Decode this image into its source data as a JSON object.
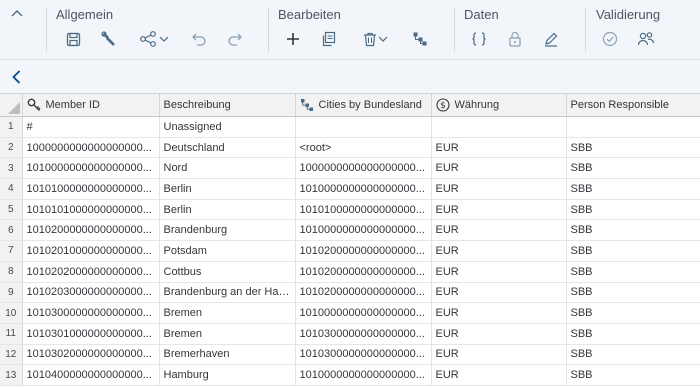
{
  "toolbar": {
    "groups": [
      {
        "title": "Allgemein",
        "items": [
          "save-icon",
          "tools-icon",
          "share-icon",
          "undo-icon",
          "redo-icon"
        ]
      },
      {
        "title": "Bearbeiten",
        "items": [
          "add-icon",
          "copy-icon",
          "delete-icon",
          "hierarchy-icon"
        ]
      },
      {
        "title": "Daten",
        "items": [
          "formula-icon",
          "lock-icon",
          "edit-icon"
        ]
      },
      {
        "title": "Validierung",
        "items": [
          "check-circle-icon",
          "users-icon"
        ]
      }
    ]
  },
  "nav": {
    "back_icon": "chevron-left-icon"
  },
  "grid": {
    "columns": [
      "Member ID",
      "Beschreibung",
      "Cities by Bundesland",
      "Währung",
      "Person Responsible"
    ],
    "column_icons": [
      "key-icon",
      "",
      "hierarchy-icon",
      "currency-icon",
      ""
    ],
    "rows": [
      [
        "1",
        "#",
        "Unassigned",
        "",
        "",
        ""
      ],
      [
        "2",
        "1000000000000000000...",
        "Deutschland",
        "<root>",
        "EUR",
        "SBB"
      ],
      [
        "3",
        "1010000000000000000...",
        "Nord",
        "1000000000000000000...",
        "EUR",
        "SBB"
      ],
      [
        "4",
        "1010100000000000000...",
        "Berlin",
        "1010000000000000000...",
        "EUR",
        "SBB"
      ],
      [
        "5",
        "1010101000000000000...",
        "Berlin",
        "1010100000000000000...",
        "EUR",
        "SBB"
      ],
      [
        "6",
        "1010200000000000000...",
        "Brandenburg",
        "1010000000000000000...",
        "EUR",
        "SBB"
      ],
      [
        "7",
        "1010201000000000000...",
        "Potsdam",
        "1010200000000000000...",
        "EUR",
        "SBB"
      ],
      [
        "8",
        "1010202000000000000...",
        "Cottbus",
        "1010200000000000000...",
        "EUR",
        "SBB"
      ],
      [
        "9",
        "1010203000000000000...",
        "Brandenburg an der Havel",
        "1010200000000000000...",
        "EUR",
        "SBB"
      ],
      [
        "10",
        "1010300000000000000...",
        "Bremen",
        "1010000000000000000...",
        "EUR",
        "SBB"
      ],
      [
        "11",
        "1010301000000000000...",
        "Bremen",
        "1010300000000000000...",
        "EUR",
        "SBB"
      ],
      [
        "12",
        "1010302000000000000...",
        "Bremerhaven",
        "1010300000000000000...",
        "EUR",
        "SBB"
      ],
      [
        "13",
        "1010400000000000000...",
        "Hamburg",
        "1010000000000000000...",
        "EUR",
        "SBB"
      ]
    ]
  },
  "colors": {
    "icon": "#4a6a85",
    "toolbar_bg": "#f2f6fa",
    "header_bg": "#f2f2f2"
  }
}
